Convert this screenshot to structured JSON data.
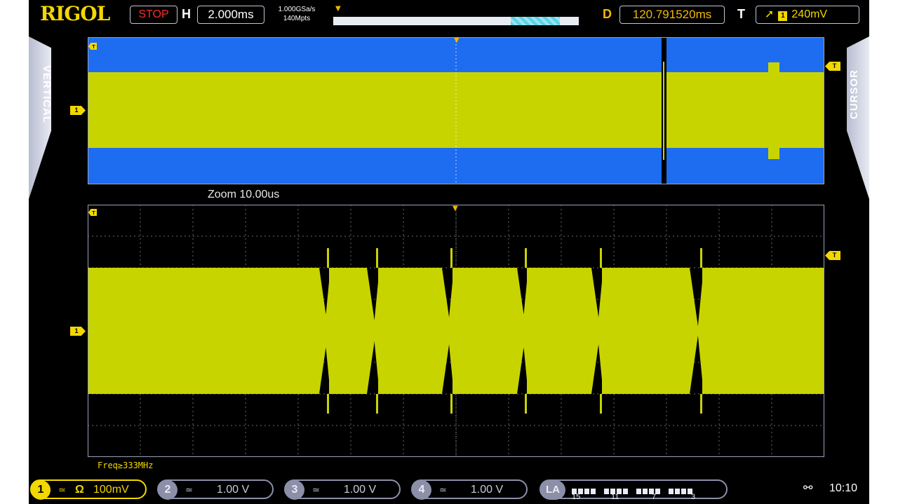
{
  "header": {
    "brand": "RIGOL",
    "run_state": "STOP",
    "h_label": "H",
    "timebase": "2.000ms",
    "sample_rate": "1.000GSa/s",
    "memory_depth": "140Mpts",
    "d_label": "D",
    "delay": "120.791520ms",
    "t_label": "T",
    "trigger_slope_icon": "rising-edge-icon",
    "trigger_channel": "1",
    "trigger_level": "240mV",
    "memory_position": 0.72
  },
  "side_tabs": {
    "left": "VERTICAL",
    "right": "CURSOR"
  },
  "zoom_label": "Zoom  10.00us",
  "measurement": "Freq≥333MHz",
  "markers": {
    "trigger": "T",
    "channel": "1"
  },
  "channels": [
    {
      "num": "1",
      "coupling": "≃",
      "impedance": "Ω",
      "scale": "100mV",
      "active": true,
      "color": "#f2d700"
    },
    {
      "num": "2",
      "coupling": "≃",
      "scale": "1.00 V",
      "active": false
    },
    {
      "num": "3",
      "coupling": "≃",
      "scale": "1.00 V",
      "active": false
    },
    {
      "num": "4",
      "coupling": "≃",
      "scale": "1.00 V",
      "active": false
    }
  ],
  "logic_analyzer": {
    "label": "LA",
    "bit_labels": [
      "15",
      "11",
      "7",
      "3"
    ]
  },
  "status": {
    "usb_icon": "usb-icon",
    "clock": "10:10"
  },
  "colors": {
    "trace": "#c8d400",
    "overview_bg": "#1e6cf0",
    "accent": "#f2d700"
  }
}
